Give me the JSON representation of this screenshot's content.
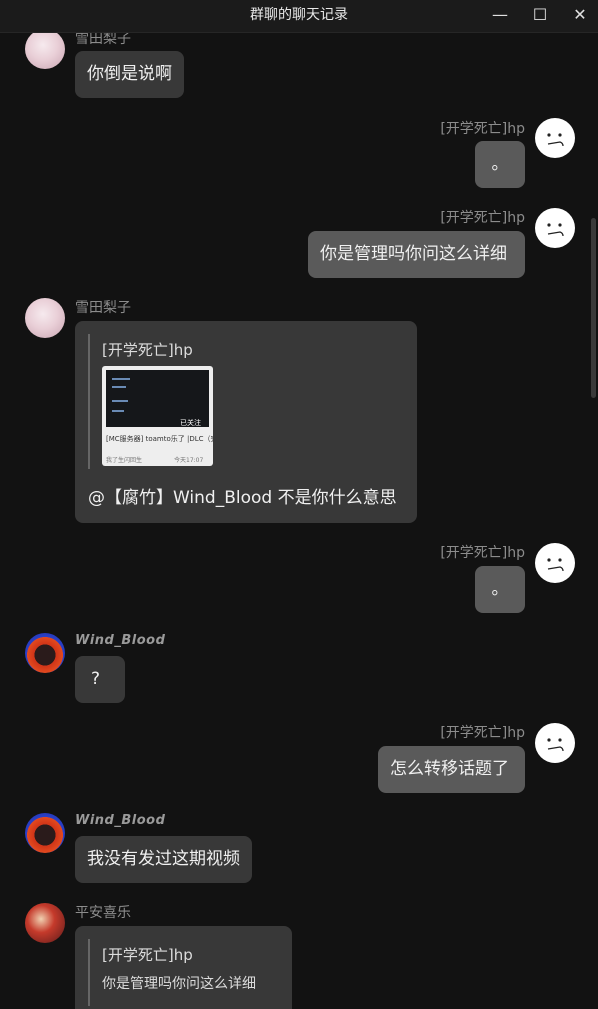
{
  "window": {
    "title": "群聊的聊天记录",
    "minimize": "—",
    "maximize": "☐",
    "close": "✕"
  },
  "messages": [
    {
      "sender": "雪田梨子",
      "text": "你倒是说啊"
    },
    {
      "sender": "[开学死亡]hp",
      "text": "。"
    },
    {
      "sender": "[开学死亡]hp",
      "text": "你是管理吗你问这么详细"
    },
    {
      "sender": "雪田梨子",
      "quote": {
        "sender": "[开学死亡]hp",
        "card_title": "[MC服务器] toamto乐了 |DLC（完美）",
        "card_meta_left": "我了生闪回生",
        "card_meta_right": "今天17:07",
        "card_tag": "已关注"
      },
      "text": "@【腐竹】Wind_Blood 不是你什么意思"
    },
    {
      "sender": "[开学死亡]hp",
      "text": "。"
    },
    {
      "sender": "Wind_Blood",
      "text": "?"
    },
    {
      "sender": "[开学死亡]hp",
      "text": "怎么转移话题了"
    },
    {
      "sender": "Wind_Blood",
      "text": "我没有发过这期视频"
    },
    {
      "sender": "平安喜乐",
      "quote": {
        "sender": "[开学死亡]hp",
        "text": "你是管理吗你问这么详细"
      }
    }
  ]
}
